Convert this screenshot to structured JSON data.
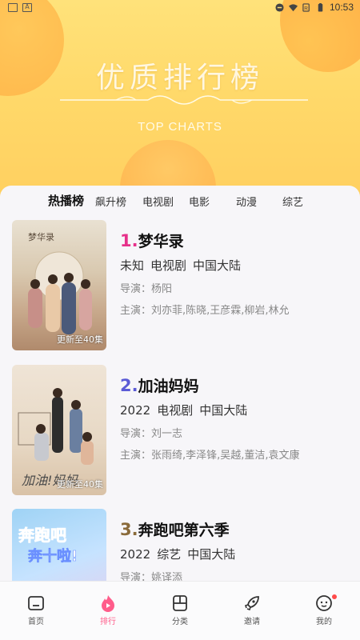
{
  "status_bar": {
    "time": "10:53"
  },
  "banner": {
    "title": "优质排行榜",
    "subtitle": "TOP CHARTS"
  },
  "tabs": [
    "热播榜",
    "飙升榜",
    "电视剧",
    "电影",
    "动漫",
    "综艺"
  ],
  "active_tab": "热播榜",
  "items": [
    {
      "rank": "1.",
      "title": "梦华录",
      "year": "未知",
      "type": "电视剧",
      "region": "中国大陆",
      "director": "导演：杨阳",
      "cast": "主演：刘亦菲,陈晓,王彦霖,柳岩,林允",
      "update": "更新至40集",
      "rank_color": "#e6308a"
    },
    {
      "rank": "2.",
      "title": "加油妈妈",
      "year": "2022",
      "type": "电视剧",
      "region": "中国大陆",
      "director": "导演：刘一志",
      "cast": "主演：张雨绮,李泽锋,吴越,董洁,袁文康",
      "update": "更新至40集",
      "rank_color": "#5b5bd6"
    },
    {
      "rank": "3.",
      "title": "奔跑吧第六季",
      "year": "2022",
      "type": "综艺",
      "region": "中国大陆",
      "director": "导演：姚译添",
      "cast": "",
      "update": "",
      "rank_color": "#8a6a3a"
    }
  ],
  "nav": [
    {
      "label": "首页",
      "icon": "home-icon"
    },
    {
      "label": "排行",
      "icon": "flame-icon",
      "active": true
    },
    {
      "label": "分类",
      "icon": "category-icon"
    },
    {
      "label": "邀请",
      "icon": "rocket-icon"
    },
    {
      "label": "我的",
      "icon": "profile-icon"
    }
  ]
}
